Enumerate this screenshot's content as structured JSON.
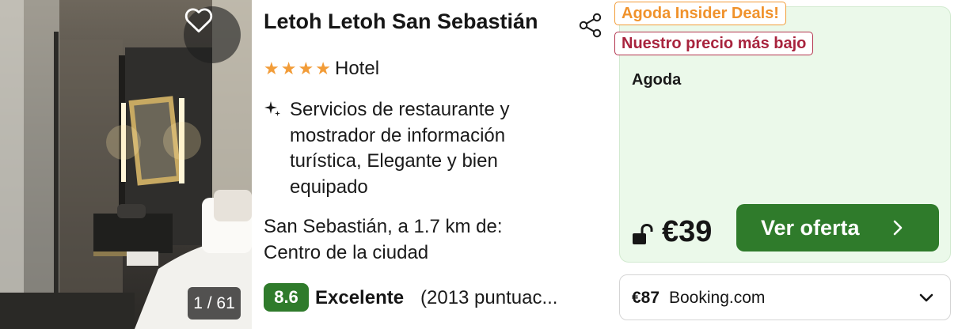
{
  "hotel": {
    "name": "Letoh Letoh San Sebastián",
    "stars": 4,
    "type": "Hotel",
    "features": "Servicios de restaurante y mostrador de información turística, Elegante y bien equipado",
    "location": "San Sebastián, a 1.7 km de: Centro de la ciudad"
  },
  "photo": {
    "counter": "1 / 61",
    "favorite_icon": "heart-outline-icon"
  },
  "rating": {
    "score": "8.6",
    "label": "Excelente",
    "count": "(2013 puntuac..."
  },
  "deal": {
    "badges": [
      "Agoda Insider Deals!",
      "Nuestro precio más bajo"
    ],
    "provider": "Agoda",
    "price": "€39",
    "cta_label": "Ver oferta",
    "lock_icon": "unlocked-padlock-icon"
  },
  "alt_offer": {
    "price": "€87",
    "provider": "Booking.com"
  },
  "colors": {
    "accent_green": "#2f7b2b",
    "deal_bg": "#ebf9ea",
    "star_orange": "#f29c38",
    "lowest_price_red": "#a8233d"
  }
}
